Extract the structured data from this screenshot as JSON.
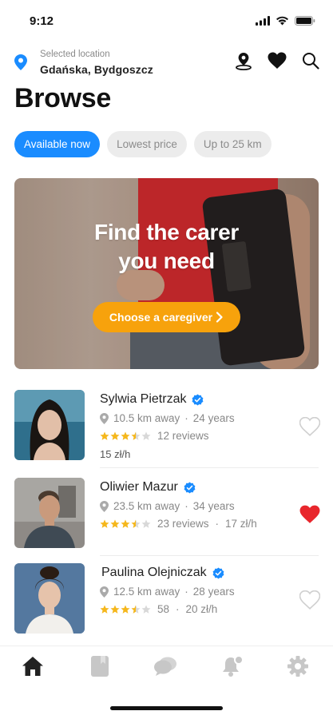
{
  "status_bar": {
    "time": "9:12"
  },
  "location": {
    "caption": "Selected location",
    "value": "Gdańska, Bydgoszcz"
  },
  "header": {
    "title": "Browse",
    "actions": [
      "map-pin-icon",
      "heart-icon",
      "search-icon"
    ]
  },
  "filters": [
    {
      "label": "Available now",
      "active": true
    },
    {
      "label": "Lowest price",
      "active": false
    },
    {
      "label": "Up to 25 km",
      "active": false
    }
  ],
  "hero": {
    "title_line1": "Find the carer",
    "title_line2": "you need",
    "cta_label": "Choose a caregiver"
  },
  "caregivers": [
    {
      "name": "Sylwia Pietrzak",
      "verified": true,
      "distance": "10.5 km away",
      "age": "24 years",
      "rating": 3.5,
      "reviews": "12 reviews",
      "price": "15 zł/h",
      "favorite": false
    },
    {
      "name": "Oliwier Mazur",
      "verified": true,
      "distance": "23.5 km away",
      "age": "34 years",
      "rating": 3.5,
      "reviews": "23 reviews",
      "price": "17 zł/h",
      "favorite": true
    },
    {
      "name": "Paulina Olejniczak",
      "verified": true,
      "distance": "12.5 km away",
      "age": "28 years",
      "rating": 3.5,
      "reviews": "58",
      "price": "20 zł/h",
      "favorite": false
    }
  ],
  "tabbar": {
    "items": [
      "home-icon",
      "book-icon",
      "chat-icon",
      "notification-icon",
      "settings-icon"
    ],
    "active_index": 0
  },
  "colors": {
    "accent": "#1a8cff",
    "cta": "#f7a20c",
    "star": "#f5b71c",
    "favorite": "#e8262c",
    "verified": "#1a8cff"
  }
}
